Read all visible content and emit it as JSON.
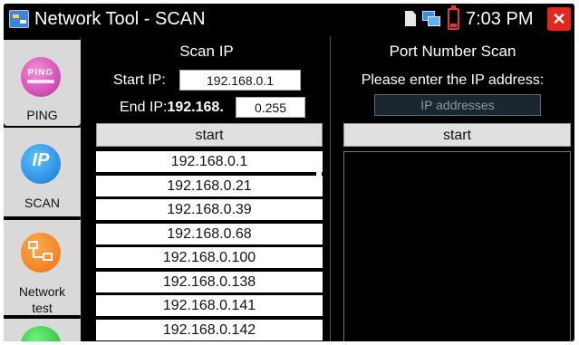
{
  "titlebar": {
    "title": "Network Tool - SCAN",
    "time": "7:03 PM",
    "close_glyph": "✕",
    "icons": [
      "sd-card-icon",
      "network-icon",
      "battery-icon",
      "close-icon"
    ]
  },
  "nav": {
    "items": [
      {
        "label": "PING",
        "icon": "ping-icon",
        "icon_text": "PING"
      },
      {
        "label": "SCAN",
        "icon": "scan-ip-icon",
        "icon_text": "IP"
      },
      {
        "label": "Network\ntest",
        "icon": "network-test-icon"
      },
      {
        "label": "",
        "icon": "green-app-icon"
      }
    ]
  },
  "scan_ip": {
    "title": "Scan IP",
    "start_ip_label": "Start IP:",
    "start_ip_value": "192.168.0.1",
    "end_ip_label_prefix": "End IP:",
    "end_ip_label_bold": "192.168.",
    "end_ip_value": "0.255",
    "start_button": "start",
    "results": [
      "192.168.0.1",
      "192.168.0.21",
      "192.168.0.39",
      "192.168.0.68",
      "192.168.0.100",
      "192.168.0.138",
      "192.168.0.141",
      "192.168.0.142"
    ]
  },
  "port_scan": {
    "title": "Port Number Scan",
    "prompt": "Please enter the IP address:",
    "ip_placeholder": "IP addresses",
    "start_button": "start"
  },
  "colors": {
    "background": "#000000",
    "close_red": "#e0291c",
    "ping_magenta": "#c12aa5",
    "scan_blue": "#1376d6",
    "network_orange": "#ee6e14",
    "green": "#20b534"
  }
}
